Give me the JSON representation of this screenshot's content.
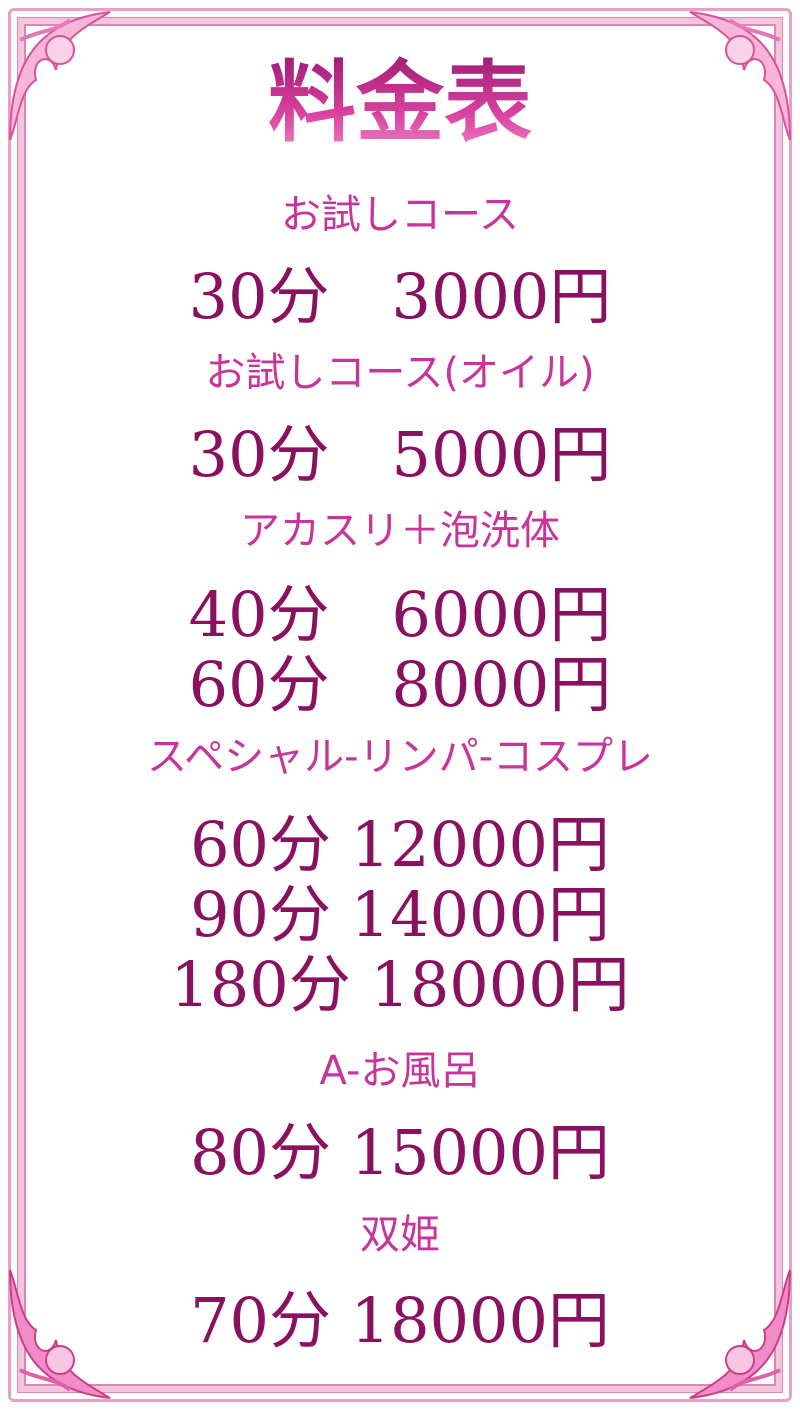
{
  "title": "料金表",
  "sections": [
    {
      "name": "お試しコース",
      "prices": [
        "30分　3000円"
      ]
    },
    {
      "name": "お試しコース(オイル)",
      "prices": [
        "30分　5000円"
      ]
    },
    {
      "name": "アカスリ＋泡洗体",
      "prices": [
        "40分　6000円",
        "60分　8000円"
      ]
    },
    {
      "name": "スペシャル-リンパ-コスプレ",
      "prices": [
        "60分 12000円",
        "90分 14000円",
        "180分 18000円"
      ]
    },
    {
      "name": "A-お風呂",
      "prices": [
        "80分 15000円"
      ]
    },
    {
      "name": "双姫",
      "prices": [
        "70分 18000円"
      ]
    }
  ],
  "colors": {
    "title": "#c0288a",
    "course": "#c7359a",
    "price": "#8a1060",
    "frame": "#f3c4dc"
  }
}
